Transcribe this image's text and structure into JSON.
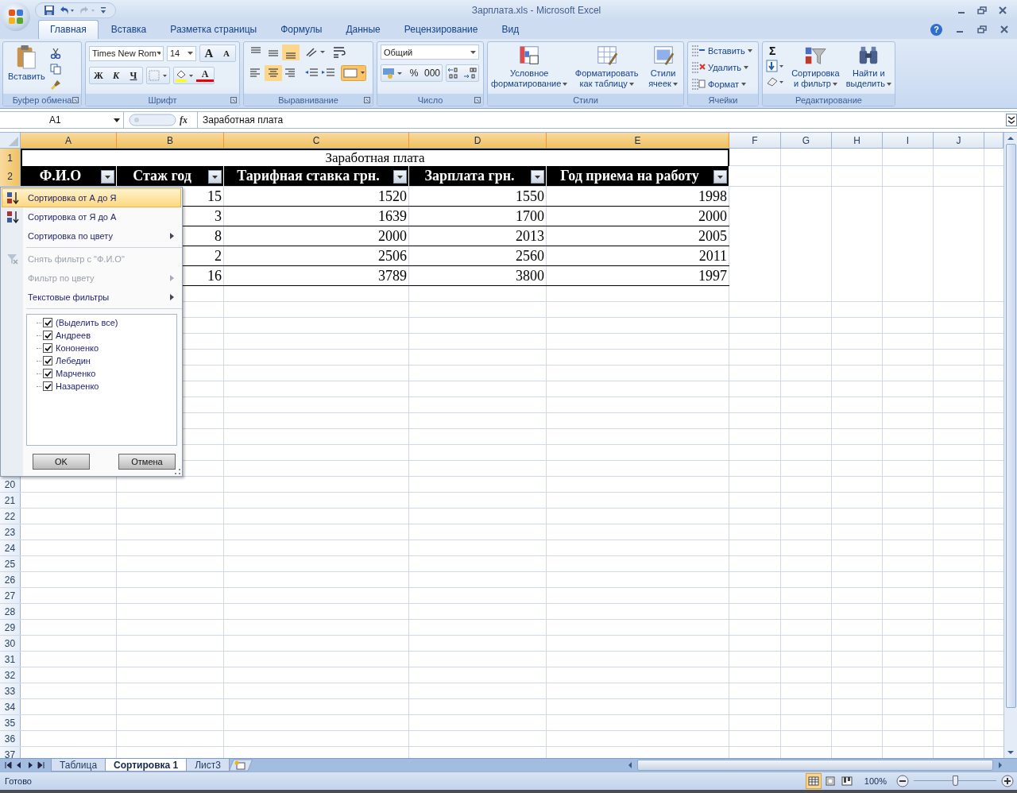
{
  "window": {
    "title": "Зарплата.xls - Microsoft Excel"
  },
  "ribbon": {
    "tabs": [
      {
        "label": "Главная",
        "selected": true
      },
      {
        "label": "Вставка",
        "selected": false
      },
      {
        "label": "Разметка страницы",
        "selected": false
      },
      {
        "label": "Формулы",
        "selected": false
      },
      {
        "label": "Данные",
        "selected": false
      },
      {
        "label": "Рецензирование",
        "selected": false
      },
      {
        "label": "Вид",
        "selected": false
      }
    ],
    "help": "?",
    "clipboard": {
      "label": "Буфер обмена",
      "paste": "Вставить"
    },
    "font": {
      "label": "Шрифт",
      "font_name": "Times New Rom",
      "font_size": "14",
      "grow": "A",
      "shrink": "A",
      "bold": "Ж",
      "italic": "К",
      "underline": "Ч",
      "font_color": "A"
    },
    "alignment": {
      "label": "Выравнивание"
    },
    "number": {
      "label": "Число",
      "format": "Общий",
      "percent": "%",
      "thousands": "000"
    },
    "styles": {
      "label": "Стили",
      "buttons": [
        "Условное форматирование",
        "Форматировать как таблицу",
        "Стили ячеек"
      ]
    },
    "cells": {
      "label": "Ячейки",
      "buttons": [
        "Вставить",
        "Удалить",
        "Формат"
      ]
    },
    "editing": {
      "label": "Редактирование",
      "sum": "Σ",
      "buttons": [
        "Сортировка и фильтр",
        "Найти и выделить"
      ]
    }
  },
  "formula_bar": {
    "name_box": "A1",
    "fx": "fx",
    "value": "Заработная плата"
  },
  "sheet": {
    "columns": [
      {
        "label": "A",
        "selected": true
      },
      {
        "label": "B",
        "selected": true
      },
      {
        "label": "C",
        "selected": true
      },
      {
        "label": "D",
        "selected": true
      },
      {
        "label": "E",
        "selected": true
      },
      {
        "label": "F",
        "selected": false
      },
      {
        "label": "G",
        "selected": false
      },
      {
        "label": "H",
        "selected": false
      },
      {
        "label": "I",
        "selected": false
      },
      {
        "label": "J",
        "selected": false
      }
    ],
    "title_row": {
      "label": "1",
      "selected": true,
      "text": "Заработная плата"
    },
    "header_row": {
      "label": "2",
      "selected": true,
      "headers": [
        "Ф.И.О",
        "Стаж год",
        "Тарифная ставка грн.",
        "Зарплата грн.",
        "Год приема на работу"
      ]
    },
    "data_rows": [
      [
        "15",
        "1520",
        "1550",
        "1998"
      ],
      [
        "3",
        "1639",
        "1700",
        "2000"
      ],
      [
        "8",
        "2000",
        "2013",
        "2005"
      ],
      [
        "2",
        "2506",
        "2560",
        "2011"
      ],
      [
        "16",
        "3789",
        "3800",
        "1997"
      ]
    ],
    "lower_rows": [
      "20",
      "21",
      "22",
      "23",
      "24",
      "25",
      "26",
      "27",
      "28",
      "29",
      "30",
      "31",
      "32",
      "33",
      "34",
      "35",
      "36",
      "37"
    ]
  },
  "filter_menu": {
    "sections": [
      [
        {
          "label": "Сортировка от А до Я",
          "highlighted": true,
          "disabled": false,
          "submenu": false
        },
        {
          "label": "Сортировка от Я до А",
          "highlighted": false,
          "disabled": false,
          "submenu": false
        },
        {
          "label": "Сортировка по цвету",
          "highlighted": false,
          "disabled": false,
          "submenu": true
        }
      ],
      [
        {
          "label": "Снять фильтр с \"Ф.И.О\"",
          "highlighted": false,
          "disabled": true,
          "submenu": false
        },
        {
          "label": "Фильтр по цвету",
          "highlighted": false,
          "disabled": true,
          "submenu": true
        },
        {
          "label": "Текстовые фильтры",
          "highlighted": false,
          "disabled": false,
          "submenu": true
        }
      ]
    ],
    "values": [
      {
        "label": "(Выделить все)",
        "checked": true
      },
      {
        "label": "Андреев",
        "checked": true
      },
      {
        "label": "Кононенко",
        "checked": true
      },
      {
        "label": "Лебедин",
        "checked": true
      },
      {
        "label": "Марченко",
        "checked": true
      },
      {
        "label": "Назаренко",
        "checked": true
      }
    ],
    "buttons": [
      "OK",
      "Отмена"
    ]
  },
  "sheet_tabs": [
    {
      "label": "Таблица",
      "selected": false
    },
    {
      "label": "Сортировка 1",
      "selected": true
    },
    {
      "label": "Лист3",
      "selected": false
    }
  ],
  "status_bar": {
    "status": "Готово",
    "views": [
      {
        "selected": true
      },
      {
        "selected": false
      },
      {
        "selected": false
      }
    ],
    "zoom": "100%",
    "zoom_slider": {
      "level": 0.5
    }
  }
}
